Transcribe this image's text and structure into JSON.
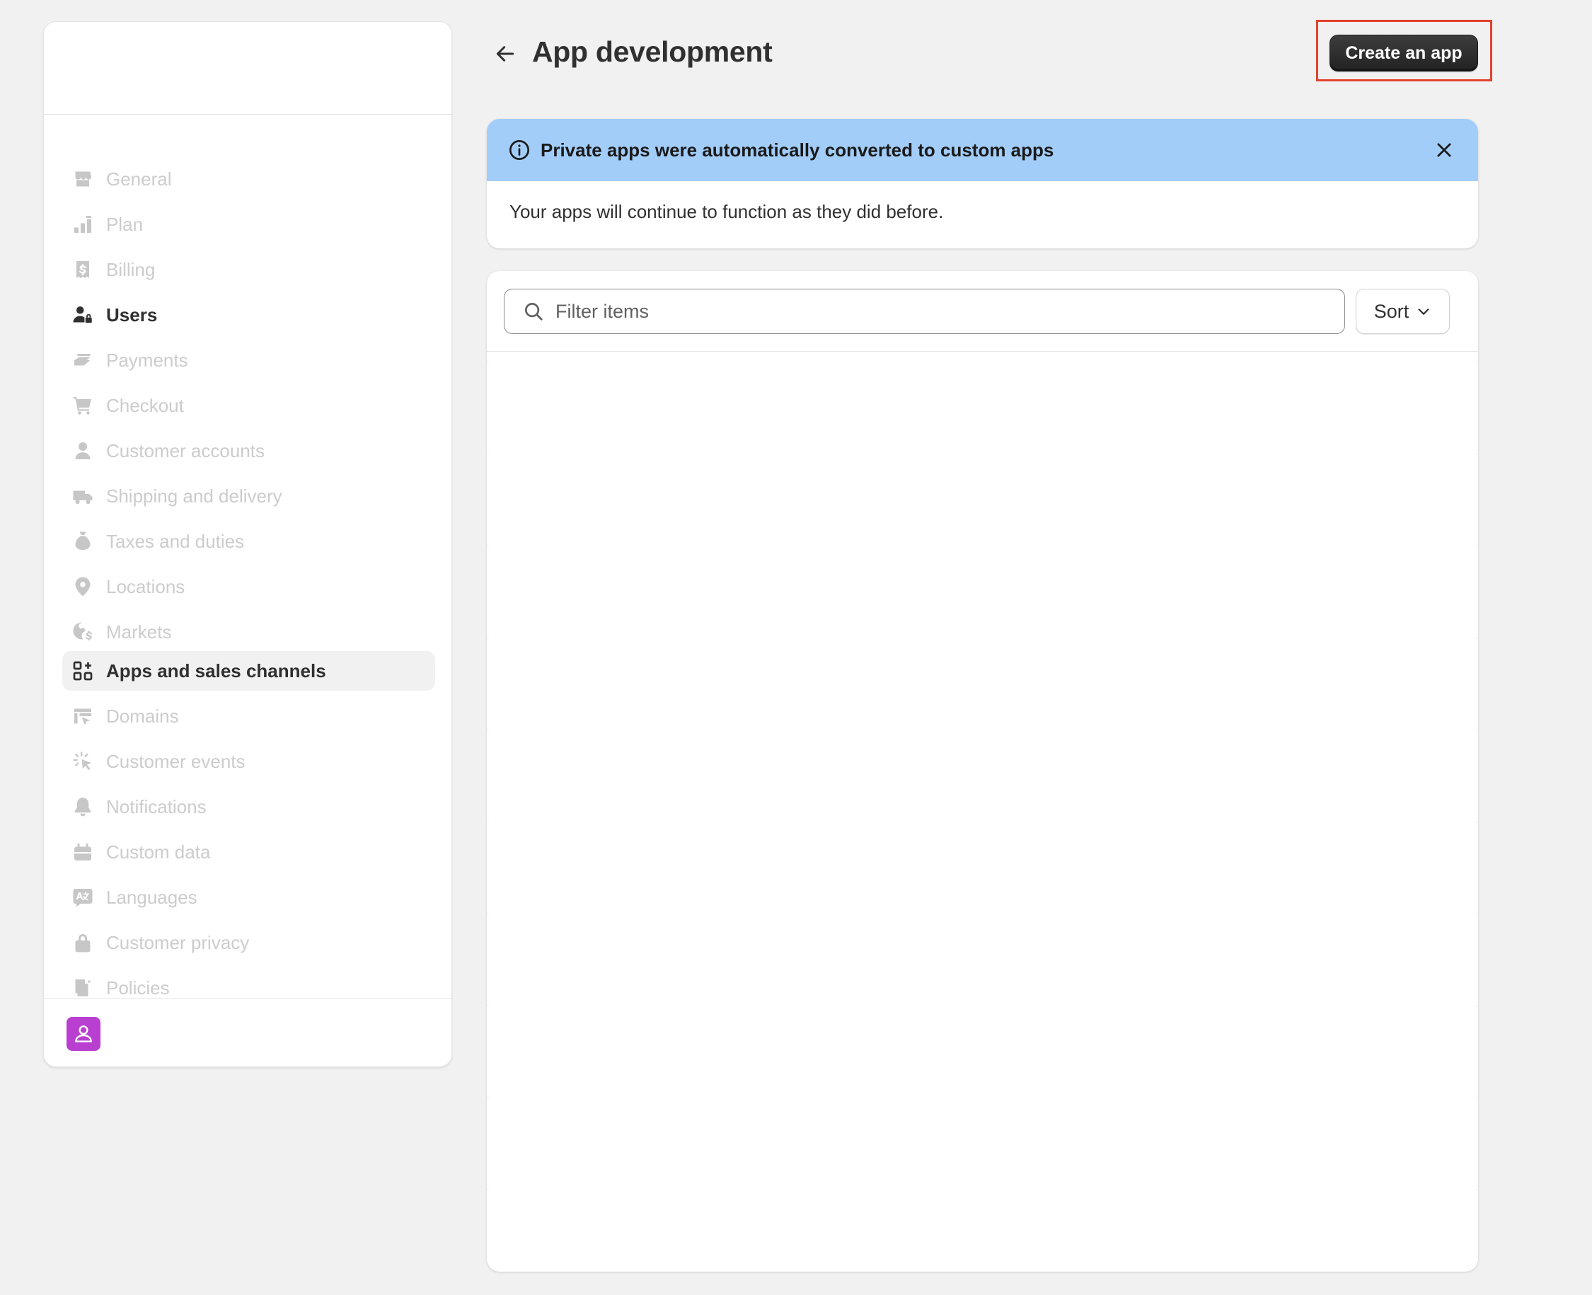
{
  "header": {
    "title": "App development",
    "create_button_label": "Create an app"
  },
  "sidebar": {
    "items": [
      {
        "label": "General",
        "icon": "store-icon"
      },
      {
        "label": "Plan",
        "icon": "plan-icon"
      },
      {
        "label": "Billing",
        "icon": "billing-icon"
      },
      {
        "label": "Users",
        "icon": "users-icon"
      },
      {
        "label": "Payments",
        "icon": "payments-icon"
      },
      {
        "label": "Checkout",
        "icon": "cart-icon"
      },
      {
        "label": "Customer accounts",
        "icon": "person-icon"
      },
      {
        "label": "Shipping and delivery",
        "icon": "truck-icon"
      },
      {
        "label": "Taxes and duties",
        "icon": "tax-icon"
      },
      {
        "label": "Locations",
        "icon": "location-icon"
      },
      {
        "label": "Markets",
        "icon": "globe-icon"
      },
      {
        "label": "Apps and sales channels",
        "icon": "apps-icon"
      },
      {
        "label": "Domains",
        "icon": "domains-icon"
      },
      {
        "label": "Customer events",
        "icon": "cursor-icon"
      },
      {
        "label": "Notifications",
        "icon": "bell-icon"
      },
      {
        "label": "Custom data",
        "icon": "data-icon"
      },
      {
        "label": "Languages",
        "icon": "language-icon"
      },
      {
        "label": "Customer privacy",
        "icon": "lock-icon"
      },
      {
        "label": "Policies",
        "icon": "policy-icon"
      }
    ]
  },
  "banner": {
    "title": "Private apps were automatically converted to custom apps",
    "body": "Your apps will continue to function as they did before."
  },
  "list": {
    "filter_placeholder": "Filter items",
    "sort_label": "Sort"
  },
  "colors": {
    "banner_bg": "#a3cdf9",
    "avatar_bg": "#b93fd0",
    "highlight_border": "#e2422d",
    "primary_button": "#303030"
  }
}
